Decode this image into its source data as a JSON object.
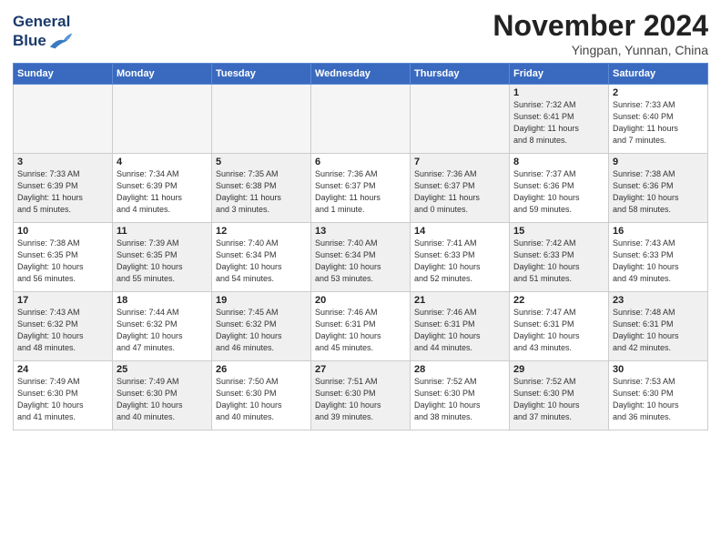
{
  "header": {
    "logo_line1": "General",
    "logo_line2": "Blue",
    "month": "November 2024",
    "location": "Yingpan, Yunnan, China"
  },
  "weekdays": [
    "Sunday",
    "Monday",
    "Tuesday",
    "Wednesday",
    "Thursday",
    "Friday",
    "Saturday"
  ],
  "weeks": [
    [
      {
        "day": "",
        "info": "",
        "empty": true
      },
      {
        "day": "",
        "info": "",
        "empty": true
      },
      {
        "day": "",
        "info": "",
        "empty": true
      },
      {
        "day": "",
        "info": "",
        "empty": true
      },
      {
        "day": "",
        "info": "",
        "empty": true
      },
      {
        "day": "1",
        "info": "Sunrise: 7:32 AM\nSunset: 6:41 PM\nDaylight: 11 hours\nand 8 minutes.",
        "shaded": true
      },
      {
        "day": "2",
        "info": "Sunrise: 7:33 AM\nSunset: 6:40 PM\nDaylight: 11 hours\nand 7 minutes.",
        "shaded": false
      }
    ],
    [
      {
        "day": "3",
        "info": "Sunrise: 7:33 AM\nSunset: 6:39 PM\nDaylight: 11 hours\nand 5 minutes.",
        "shaded": true
      },
      {
        "day": "4",
        "info": "Sunrise: 7:34 AM\nSunset: 6:39 PM\nDaylight: 11 hours\nand 4 minutes.",
        "shaded": false
      },
      {
        "day": "5",
        "info": "Sunrise: 7:35 AM\nSunset: 6:38 PM\nDaylight: 11 hours\nand 3 minutes.",
        "shaded": true
      },
      {
        "day": "6",
        "info": "Sunrise: 7:36 AM\nSunset: 6:37 PM\nDaylight: 11 hours\nand 1 minute.",
        "shaded": false
      },
      {
        "day": "7",
        "info": "Sunrise: 7:36 AM\nSunset: 6:37 PM\nDaylight: 11 hours\nand 0 minutes.",
        "shaded": true
      },
      {
        "day": "8",
        "info": "Sunrise: 7:37 AM\nSunset: 6:36 PM\nDaylight: 10 hours\nand 59 minutes.",
        "shaded": false
      },
      {
        "day": "9",
        "info": "Sunrise: 7:38 AM\nSunset: 6:36 PM\nDaylight: 10 hours\nand 58 minutes.",
        "shaded": true
      }
    ],
    [
      {
        "day": "10",
        "info": "Sunrise: 7:38 AM\nSunset: 6:35 PM\nDaylight: 10 hours\nand 56 minutes.",
        "shaded": false
      },
      {
        "day": "11",
        "info": "Sunrise: 7:39 AM\nSunset: 6:35 PM\nDaylight: 10 hours\nand 55 minutes.",
        "shaded": true
      },
      {
        "day": "12",
        "info": "Sunrise: 7:40 AM\nSunset: 6:34 PM\nDaylight: 10 hours\nand 54 minutes.",
        "shaded": false
      },
      {
        "day": "13",
        "info": "Sunrise: 7:40 AM\nSunset: 6:34 PM\nDaylight: 10 hours\nand 53 minutes.",
        "shaded": true
      },
      {
        "day": "14",
        "info": "Sunrise: 7:41 AM\nSunset: 6:33 PM\nDaylight: 10 hours\nand 52 minutes.",
        "shaded": false
      },
      {
        "day": "15",
        "info": "Sunrise: 7:42 AM\nSunset: 6:33 PM\nDaylight: 10 hours\nand 51 minutes.",
        "shaded": true
      },
      {
        "day": "16",
        "info": "Sunrise: 7:43 AM\nSunset: 6:33 PM\nDaylight: 10 hours\nand 49 minutes.",
        "shaded": false
      }
    ],
    [
      {
        "day": "17",
        "info": "Sunrise: 7:43 AM\nSunset: 6:32 PM\nDaylight: 10 hours\nand 48 minutes.",
        "shaded": true
      },
      {
        "day": "18",
        "info": "Sunrise: 7:44 AM\nSunset: 6:32 PM\nDaylight: 10 hours\nand 47 minutes.",
        "shaded": false
      },
      {
        "day": "19",
        "info": "Sunrise: 7:45 AM\nSunset: 6:32 PM\nDaylight: 10 hours\nand 46 minutes.",
        "shaded": true
      },
      {
        "day": "20",
        "info": "Sunrise: 7:46 AM\nSunset: 6:31 PM\nDaylight: 10 hours\nand 45 minutes.",
        "shaded": false
      },
      {
        "day": "21",
        "info": "Sunrise: 7:46 AM\nSunset: 6:31 PM\nDaylight: 10 hours\nand 44 minutes.",
        "shaded": true
      },
      {
        "day": "22",
        "info": "Sunrise: 7:47 AM\nSunset: 6:31 PM\nDaylight: 10 hours\nand 43 minutes.",
        "shaded": false
      },
      {
        "day": "23",
        "info": "Sunrise: 7:48 AM\nSunset: 6:31 PM\nDaylight: 10 hours\nand 42 minutes.",
        "shaded": true
      }
    ],
    [
      {
        "day": "24",
        "info": "Sunrise: 7:49 AM\nSunset: 6:30 PM\nDaylight: 10 hours\nand 41 minutes.",
        "shaded": false
      },
      {
        "day": "25",
        "info": "Sunrise: 7:49 AM\nSunset: 6:30 PM\nDaylight: 10 hours\nand 40 minutes.",
        "shaded": true
      },
      {
        "day": "26",
        "info": "Sunrise: 7:50 AM\nSunset: 6:30 PM\nDaylight: 10 hours\nand 40 minutes.",
        "shaded": false
      },
      {
        "day": "27",
        "info": "Sunrise: 7:51 AM\nSunset: 6:30 PM\nDaylight: 10 hours\nand 39 minutes.",
        "shaded": true
      },
      {
        "day": "28",
        "info": "Sunrise: 7:52 AM\nSunset: 6:30 PM\nDaylight: 10 hours\nand 38 minutes.",
        "shaded": false
      },
      {
        "day": "29",
        "info": "Sunrise: 7:52 AM\nSunset: 6:30 PM\nDaylight: 10 hours\nand 37 minutes.",
        "shaded": true
      },
      {
        "day": "30",
        "info": "Sunrise: 7:53 AM\nSunset: 6:30 PM\nDaylight: 10 hours\nand 36 minutes.",
        "shaded": false
      }
    ]
  ]
}
